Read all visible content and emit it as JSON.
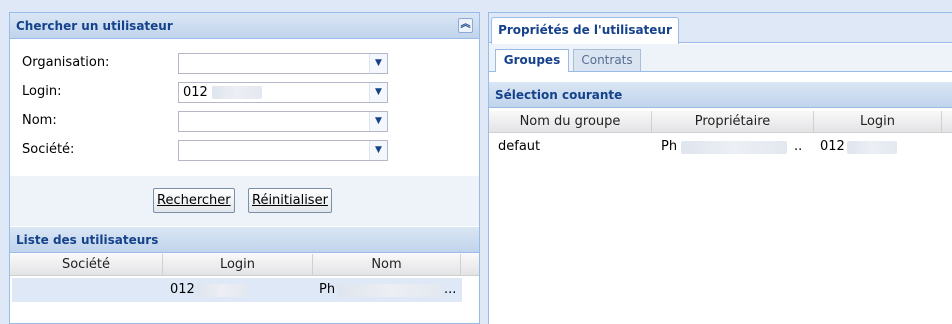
{
  "search_panel": {
    "title": "Chercher un utilisateur",
    "collapse_glyph": "»",
    "fields": [
      {
        "label": "Organisation:",
        "value": ""
      },
      {
        "label": "Login:",
        "value": "012"
      },
      {
        "label": "Nom:",
        "value": ""
      },
      {
        "label": "Société:",
        "value": ""
      }
    ],
    "search_button": "Rechercher",
    "reset_button": "Réinitialiser"
  },
  "users_list": {
    "title": "Liste des utilisateurs",
    "columns": [
      "Société",
      "Login",
      "Nom"
    ],
    "rows": [
      {
        "societe": "",
        "login": "012",
        "nom": "Ph",
        "nom_ellipsis": "..."
      }
    ]
  },
  "properties": {
    "tab": "Propriétés de l'utilisateur",
    "subtabs": [
      "Groupes",
      "Contrats"
    ],
    "section_title": "Sélection courante",
    "columns": [
      "Nom du groupe",
      "Propriétaire",
      "Login"
    ],
    "rows": [
      {
        "group": "defaut",
        "owner": "Ph",
        "owner_ellipsis": "..",
        "login": "012"
      }
    ]
  },
  "icons": {
    "dropdown": "chevron-down-icon",
    "collapse": "double-chevron-up-icon"
  }
}
